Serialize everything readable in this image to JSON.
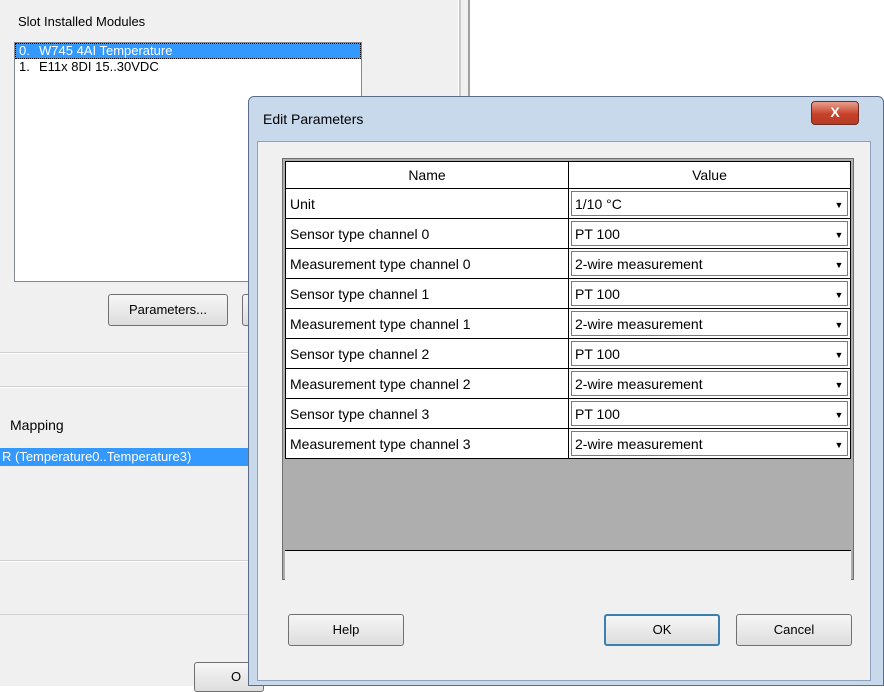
{
  "background": {
    "slot_header": "Slot  Installed Modules",
    "modules": [
      {
        "num": "0.",
        "name": "W745 4AI Temperature",
        "selected": true
      },
      {
        "num": "1.",
        "name": "E11x 8DI 15..30VDC",
        "selected": false
      }
    ],
    "parameters_button": "Parameters...",
    "mapping_label": "Mapping",
    "mapping_row": "R (Temperature0..Temperature3)",
    "bottom_button_partial": "O"
  },
  "dialog": {
    "title": "Edit Parameters",
    "close_glyph": "X",
    "columns": {
      "name": "Name",
      "value": "Value"
    },
    "rows": [
      {
        "name": "Unit",
        "value": "1/10 °C"
      },
      {
        "name": "Sensor type channel 0",
        "value": "PT 100"
      },
      {
        "name": "Measurement type channel 0",
        "value": "2-wire measurement"
      },
      {
        "name": "Sensor type channel 1",
        "value": "PT 100"
      },
      {
        "name": "Measurement type channel 1",
        "value": "2-wire measurement"
      },
      {
        "name": "Sensor type channel 2",
        "value": "PT 100"
      },
      {
        "name": "Measurement type channel 2",
        "value": "2-wire measurement"
      },
      {
        "name": "Sensor type channel 3",
        "value": "PT 100"
      },
      {
        "name": "Measurement type channel 3",
        "value": "2-wire measurement"
      }
    ],
    "buttons": {
      "help": "Help",
      "ok": "OK",
      "cancel": "Cancel"
    },
    "dropdown_icon": "chevron-down-icon"
  }
}
